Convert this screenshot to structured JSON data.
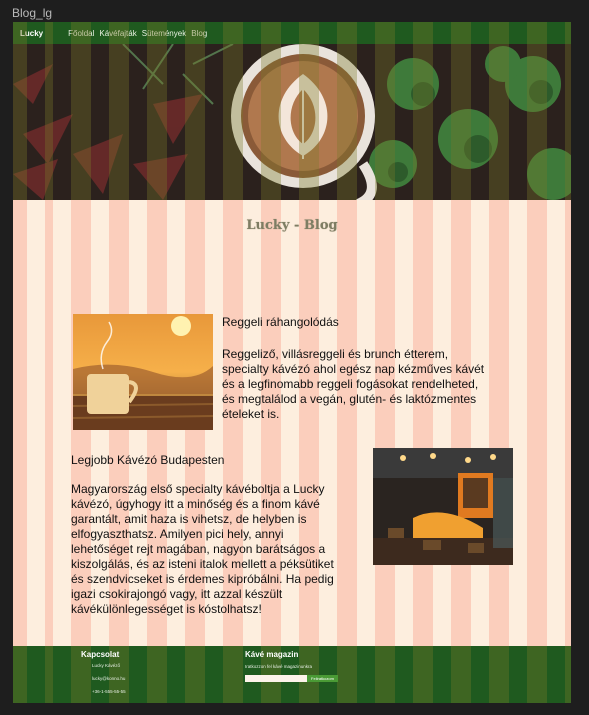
{
  "frame": {
    "label": "Blog_lg"
  },
  "nav": {
    "brand": "Lucky",
    "links": [
      "Főoldal",
      "Kávéfajták",
      "Sütemények",
      "Blog"
    ]
  },
  "page": {
    "title": "Lucky - Blog"
  },
  "posts": [
    {
      "title": "Reggeli ráhangolódás",
      "lines": [
        "Reggeliző, villásreggeli és brunch étterem,",
        "specialty kávézó ahol egész nap kézműves kávét",
        "és a legfinomabb reggeli fogásokat rendelheted,",
        "és megtalálod a vegán, glutén- és laktózmentes",
        "ételeket is."
      ],
      "image": "coffee-cup-sunset-photo"
    },
    {
      "title": "Legjobb Kávézó Budapesten",
      "lines": [
        "Magyarország első specialty kávéboltja a Lucky",
        "kávézó, úgyhogy itt a minőség és a finom kávé",
        "garantált, amit haza is vihetsz, de helyben is",
        "elfogyaszthatsz. Amilyen pici hely, annyi",
        "lehetőséget rejt magában, nagyon barátságos a",
        "kiszolgálás, és az isteni italok mellett a péksütiket",
        "és szendvicseket is érdemes kipróbálni. Ha pedig",
        "igazi csokirajongó vagy, itt azzal készült",
        "kávékülönlegességet is kóstolhatsz!"
      ],
      "image": "cafe-interior-photo"
    }
  ],
  "footer": {
    "contact": {
      "heading": "Kapcsolat",
      "name": "Lucky Kávéző",
      "email": "lucky@konno.hu",
      "phone": "+36-1-555-55-55"
    },
    "magazine": {
      "heading": "Kávé magazin",
      "subtext": "Iratkozzon fel kávé magazinunkra",
      "input_value": "",
      "button_label": "Feliratkozom"
    }
  },
  "colors": {
    "nav_bg": "#1f5a1f",
    "page_bg": "#fdeede",
    "stripe": "#f9c4b0",
    "title": "#7e7d63",
    "button": "#4a9a35"
  }
}
